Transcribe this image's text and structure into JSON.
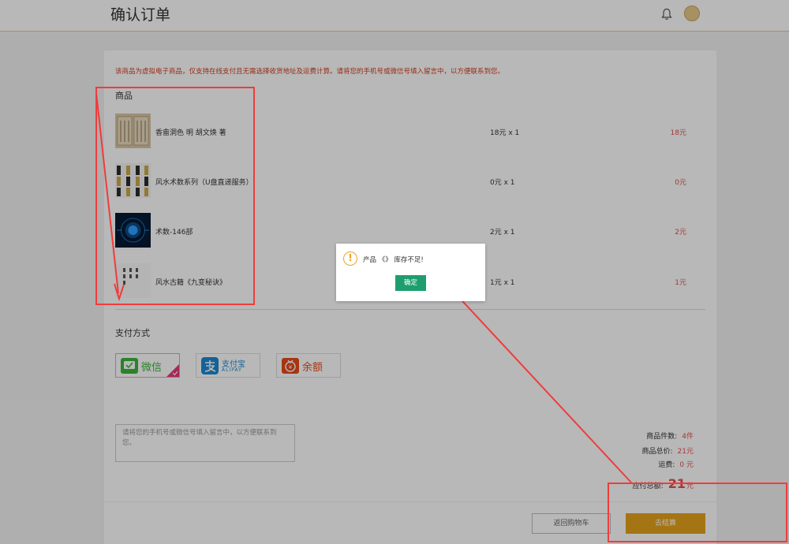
{
  "header": {
    "title": "确认订单",
    "bell_icon": "bell-icon",
    "avatar_icon": "avatar-icon"
  },
  "notice": "该商品为虚拟电子商品，仅支持在线支付且无需选择收货地址及运费计算。请将您的手机号或微信号填入留言中，以方便联系到您。",
  "products": {
    "title": "商品",
    "items": [
      {
        "name": "香畬洞色 明 胡文焕 著",
        "qty": "18元 x 1",
        "total": "18元"
      },
      {
        "name": "风水术数系列（U盘直递服务）",
        "qty": "0元 x 1",
        "total": "0元"
      },
      {
        "name": "术数-146部",
        "qty": "2元 x 1",
        "total": "2元"
      },
      {
        "name": "风水古籍《九变秘诀》",
        "qty": "1元 x 1",
        "total": "1元"
      }
    ]
  },
  "payment": {
    "title": "支付方式",
    "wechat": "微信",
    "alipay": "支付宝",
    "alipay_sub": "ALIPAY",
    "balance": "余额",
    "colors": {
      "wechat": "#3bb53b",
      "alipay": "#1e88d2",
      "balance": "#e64a19"
    }
  },
  "memo": {
    "placeholder": "请将您的手机号或微信号填入留言中，以方便联系到您。"
  },
  "summary": {
    "count_label": "商品件数:",
    "count_value": "4件",
    "total_label": "商品总价:",
    "total_value": "21元",
    "shipping_label": "运费:",
    "shipping_value": "0 元",
    "pay_label": "应付总额:",
    "pay_value": "21",
    "pay_unit": "元"
  },
  "footer": {
    "back": "返回购物车",
    "checkout": "去结算"
  },
  "dialog": {
    "message": "产品 《》 库存不足!",
    "ok": "确定",
    "icon": "warning-icon"
  },
  "colors": {
    "accent": "#e5a21c",
    "price": "#e05050",
    "ok": "#1e9e6f",
    "annotation": "#f03c3c"
  }
}
